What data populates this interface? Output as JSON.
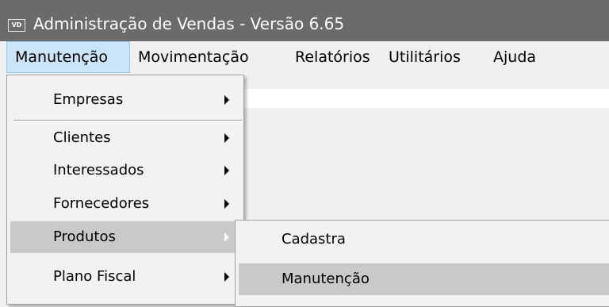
{
  "window": {
    "icon_text": "VD",
    "title": "Administração de Vendas - Versão 6.65"
  },
  "menubar": {
    "items": [
      {
        "label": "Manutenção",
        "active": true
      },
      {
        "label": "Movimentação"
      },
      {
        "label": "Relatórios"
      },
      {
        "label": "Utilitários"
      },
      {
        "label": "Ajuda"
      }
    ]
  },
  "manutencao_menu": {
    "items": [
      {
        "label": "Empresas",
        "submenu": true
      },
      {
        "label": "Clientes",
        "submenu": true
      },
      {
        "label": "Interessados",
        "submenu": true
      },
      {
        "label": "Fornecedores",
        "submenu": true
      },
      {
        "label": "Produtos",
        "submenu": true,
        "highlighted": true
      },
      {
        "label": "Plano Fiscal",
        "submenu": true
      }
    ]
  },
  "produtos_submenu": {
    "items": [
      {
        "label": "Cadastra"
      },
      {
        "label": "Manutenção",
        "highlighted": true
      }
    ]
  },
  "colors": {
    "titlebar": "#6b6b6b",
    "menubar_active_bg": "#cce4f7",
    "menubar_active_border": "#99c9ef",
    "menu_bg": "#f2f2f2",
    "menu_highlight": "#c9c9c9"
  }
}
